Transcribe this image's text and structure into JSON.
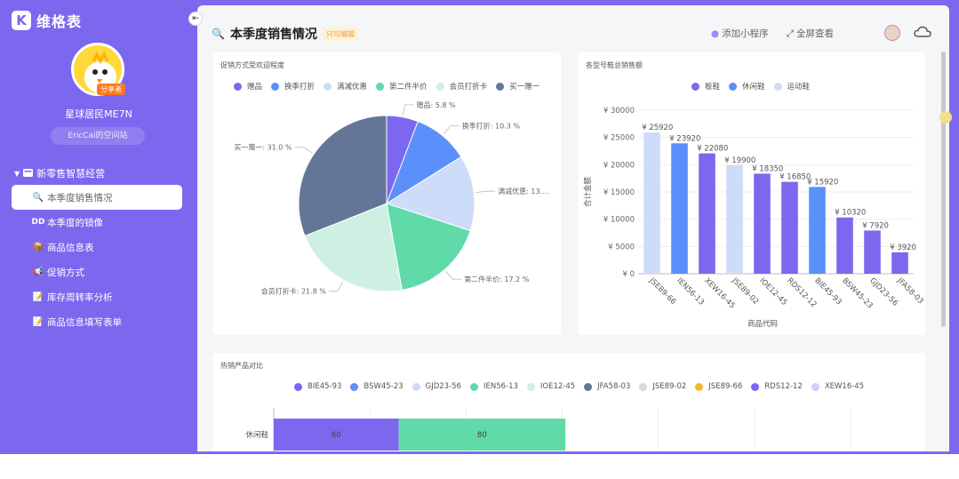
{
  "app": {
    "logo_letter": "K",
    "name": "维格表"
  },
  "user": {
    "name": "星球居民ME7N",
    "badge": "分享者",
    "space_button": "EricCai的空间站"
  },
  "nav": {
    "group_label": "新零售智慧经营",
    "items": [
      {
        "icon": "🔍",
        "label": "本季度销售情况",
        "active": true
      },
      {
        "icon": "DD",
        "label": "本季度的镜像",
        "active": false
      },
      {
        "icon": "📦",
        "label": "商品信息表",
        "active": false
      },
      {
        "icon": "📢",
        "label": "促销方式",
        "active": false
      },
      {
        "icon": "📝",
        "label": "库存周转率分析",
        "active": false
      },
      {
        "icon": "📝",
        "label": "商品信息填写表单",
        "active": false
      }
    ]
  },
  "header": {
    "title_icon": "🔍",
    "title": "本季度销售情况",
    "badge": "只可编辑",
    "add_mini_program": "添加小程序",
    "fullscreen": "全屏查看"
  },
  "colors": {
    "accent": "#7b68ee",
    "pie": [
      "#7b68ee",
      "#5b8ff9",
      "#cddcf8",
      "#5fdaa8",
      "#cdf0e2",
      "#647697"
    ]
  },
  "chart_data": [
    {
      "type": "pie",
      "title": "促销方式受欢迎程度",
      "legend": [
        "赠品",
        "换季打折",
        "满减优惠",
        "第二件半价",
        "会员打折卡",
        "买一赠一"
      ],
      "slices": [
        {
          "name": "赠品",
          "value": 5.8,
          "label": "赠品: 5.8 %"
        },
        {
          "name": "换季打折",
          "value": 10.3,
          "label": "换季打折: 10.3 %"
        },
        {
          "name": "满减优惠",
          "value": 13.9,
          "label": "满减优惠: 13...."
        },
        {
          "name": "第二件半价",
          "value": 17.2,
          "label": "第二件半价: 17.2 %"
        },
        {
          "name": "会员打折卡",
          "value": 21.8,
          "label": "会员打折卡: 21.8 %"
        },
        {
          "name": "买一赠一",
          "value": 31.0,
          "label": "买一赠一: 31.0 %"
        }
      ]
    },
    {
      "type": "bar",
      "title": "各型号鞋总销售额",
      "legend": [
        {
          "name": "板鞋",
          "color": "#7b68ee"
        },
        {
          "name": "休闲鞋",
          "color": "#5b8ff9"
        },
        {
          "name": "运动鞋",
          "color": "#cddcf8"
        }
      ],
      "xlabel": "商品代码",
      "ylabel": "合计金额",
      "ylim": [
        0,
        30000
      ],
      "yticks": [
        "¥ 0",
        "¥ 5000",
        "¥ 10000",
        "¥ 15000",
        "¥ 20000",
        "¥ 25000",
        "¥ 30000"
      ],
      "categories": [
        "JSE89-66",
        "IEN56-13",
        "XEW16-45",
        "JSE89-02",
        "IOE12-45",
        "RDS12-12",
        "BIE45-93",
        "BSW45-23",
        "GJD23-56",
        "JFA58-03"
      ],
      "values": [
        25920,
        23920,
        22080,
        19900,
        18350,
        16850,
        15920,
        10320,
        7920,
        3920
      ],
      "labels": [
        "¥ 25920",
        "¥ 23920",
        "¥ 22080",
        "¥ 19900",
        "¥ 18350",
        "¥ 16850",
        "¥ 15920",
        "¥ 10320",
        "¥ 7920",
        "¥ 3920"
      ],
      "bar_colors": [
        "#cddcf8",
        "#5b8ff9",
        "#7b68ee",
        "#cddcf8",
        "#7b68ee",
        "#7b68ee",
        "#5b8ff9",
        "#7b68ee",
        "#7b68ee",
        "#7b68ee"
      ]
    },
    {
      "type": "bar",
      "orientation": "horizontal-stacked",
      "title": "热销产品对比",
      "legend": [
        {
          "name": "BIE45-93",
          "color": "#7b68ee"
        },
        {
          "name": "BSW45-23",
          "color": "#5b8ff9"
        },
        {
          "name": "GJD23-56",
          "color": "#cddcf8"
        },
        {
          "name": "IEN56-13",
          "color": "#5fdaa8"
        },
        {
          "name": "IOE12-45",
          "color": "#cdf0e2"
        },
        {
          "name": "JFA58-03",
          "color": "#647697"
        },
        {
          "name": "JSE89-02",
          "color": "#d8d8d8"
        },
        {
          "name": "JSE89-66",
          "color": "#f5b82e"
        },
        {
          "name": "RDS12-12",
          "color": "#7b68ee"
        },
        {
          "name": "XEW16-45",
          "color": "#d4cff8"
        }
      ],
      "categories": [
        "休闲鞋"
      ],
      "segments": [
        {
          "name": "BIE45-93",
          "value": 60,
          "color": "#7b68ee"
        },
        {
          "name": "IEN56-13",
          "value": 80,
          "color": "#5fdaa8"
        }
      ],
      "xlim": [
        0,
        300
      ]
    }
  ]
}
